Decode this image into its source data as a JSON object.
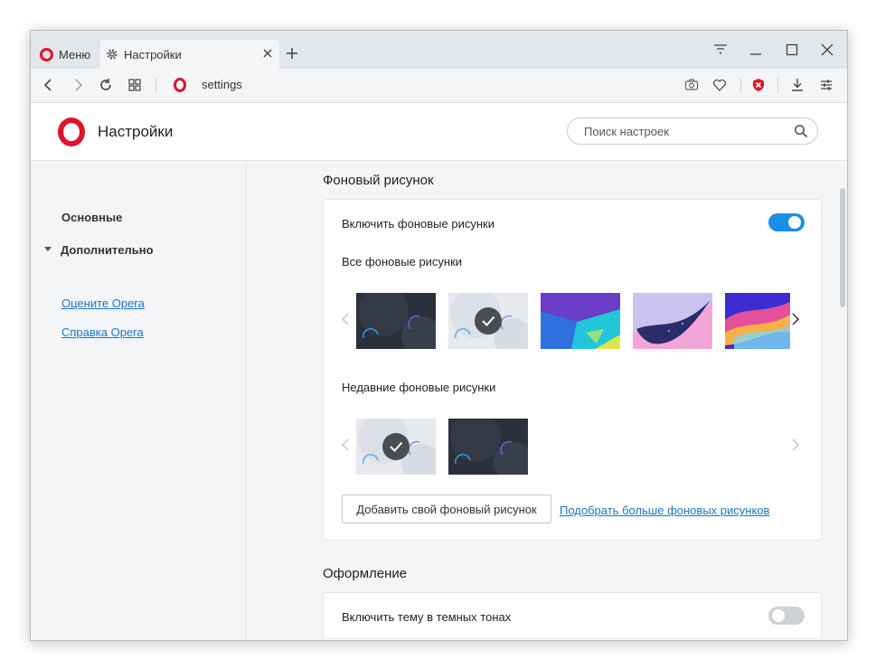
{
  "tabs": {
    "menu_label": "Меню",
    "active_label": "Настройки"
  },
  "address": {
    "url": "settings"
  },
  "header": {
    "title": "Настройки",
    "search_placeholder": "Поиск настроек"
  },
  "sidebar": {
    "items": [
      {
        "label": "Основные"
      },
      {
        "label": "Дополнительно"
      }
    ],
    "links": [
      {
        "label": "Оцените Opera"
      },
      {
        "label": "Справка Opera"
      }
    ]
  },
  "wallpaper_section": {
    "title": "Фоновый рисунок",
    "enable_label": "Включить фоновые рисунки",
    "enable_on": true,
    "all_label": "Все фоновые рисунки",
    "recent_label": "Недавние фоновые рисунки",
    "add_button": "Добавить свой фоновый рисунок",
    "more_link": "Подобрать больше фоновых рисунков"
  },
  "appearance_section": {
    "title": "Оформление",
    "dark_theme_label": "Включить тему в темных тонах",
    "dark_theme_on": false
  },
  "colors": {
    "accent": "#1a8fe8",
    "brand": "#e0132a",
    "link": "#1a74c9"
  }
}
